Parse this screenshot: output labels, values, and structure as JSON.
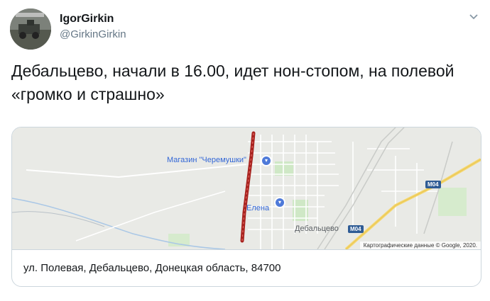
{
  "author": {
    "display_name": "IgorGirkin",
    "handle": "@GirkinGirkin",
    "avatar_icon": "avatar-photo"
  },
  "menu": {
    "icon": "chevron-down-icon"
  },
  "tweet": {
    "text": "Дебальцево, начали в 16.00, идет нон-стопом, на полевой  «громко и страшно»"
  },
  "card": {
    "map": {
      "labels": {
        "shop": "Магазин \"Черемушки\"",
        "elena": "Елена",
        "city": "Дебальцево",
        "road_1": "M04",
        "road_2": "M04",
        "attribution": "Картографические данные © Google, 2020."
      },
      "colors": {
        "route": "#a7231f",
        "land": "#e9eae6",
        "roads": "#ffffff",
        "highway": "#f5d76e",
        "parks": "#cfe8c6",
        "pins": "#4e7ad9"
      }
    },
    "address": "ул. Полевая, Дебальцево, Донецкая область, 84700"
  }
}
